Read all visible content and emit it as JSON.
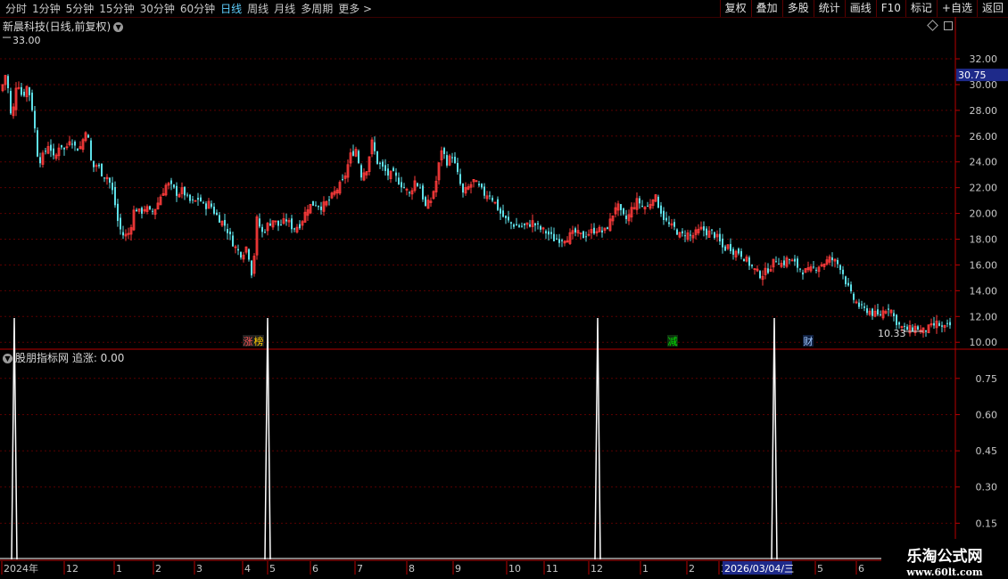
{
  "toolbar": {
    "periods": [
      "分时",
      "1分钟",
      "5分钟",
      "15分钟",
      "30分钟",
      "60分钟",
      "日线",
      "周线",
      "月线",
      "多周期",
      "更多 >"
    ],
    "active_index": 6,
    "right_buttons": [
      "复权",
      "叠加",
      "多股",
      "统计",
      "画线",
      "F10",
      "标记",
      "+自选",
      "返回"
    ]
  },
  "main": {
    "title": "新晨科技(日线,前复权)",
    "last_price": "30.75",
    "high_label": "33.00",
    "low_label": "10.33",
    "markers": [
      {
        "label": "涨",
        "color": "#ff5555",
        "bg": "#202020"
      },
      {
        "label": "榜",
        "color": "#ffcc00",
        "bg": "#202020"
      },
      {
        "label": "减",
        "color": "#00e000",
        "bg": "#103010"
      },
      {
        "label": "财",
        "color": "#a0c8ff",
        "bg": "#102040"
      }
    ]
  },
  "indicator": {
    "title": "股朋指标网 追涨: 0.00"
  },
  "date_axis": {
    "labels": [
      "2024年",
      "12",
      "1",
      "2",
      "3",
      "4",
      "5",
      "6",
      "7",
      "8",
      "9",
      "10",
      "11",
      "12",
      "1",
      "2",
      "3",
      "5",
      "6"
    ],
    "cursor_date": "2026/03/04/三"
  },
  "watermark": {
    "line1": "乐淘公式网",
    "line2": "www.60lt.com"
  },
  "colors": {
    "up": "#ff3b3b",
    "down": "#5ee0e8",
    "axis": "#b80000",
    "grid": "#5a0000",
    "bg": "#000000",
    "signal": "#ffffff"
  },
  "chart_data": [
    {
      "type": "candlestick",
      "title": "新晨科技(日线,前复权)",
      "y_ticks": [
        10.0,
        12.0,
        14.0,
        16.0,
        18.0,
        20.0,
        22.0,
        24.0,
        26.0,
        28.0,
        30.0,
        32.0
      ],
      "ylim": [
        9.6,
        33.8
      ],
      "grid": true,
      "annotations": [
        {
          "text": "33.00",
          "kind": "high"
        },
        {
          "text": "10.33",
          "kind": "low"
        },
        {
          "text": "30.75",
          "kind": "last"
        }
      ],
      "close_path": [
        [
          0,
          29.5
        ],
        [
          6,
          31.0
        ],
        [
          12,
          27.0
        ],
        [
          18,
          30.5
        ],
        [
          24,
          29.0
        ],
        [
          30,
          30.0
        ],
        [
          36,
          27.8
        ],
        [
          42,
          24.0
        ],
        [
          48,
          24.5
        ],
        [
          54,
          25.5
        ],
        [
          60,
          24.0
        ],
        [
          66,
          25.5
        ],
        [
          72,
          24.8
        ],
        [
          78,
          26.0
        ],
        [
          84,
          25.0
        ],
        [
          90,
          25.2
        ],
        [
          96,
          26.8
        ],
        [
          102,
          23.5
        ],
        [
          108,
          23.8
        ],
        [
          114,
          23.0
        ],
        [
          120,
          22.8
        ],
        [
          126,
          21.5
        ],
        [
          132,
          19.0
        ],
        [
          138,
          18.2
        ],
        [
          144,
          18.5
        ],
        [
          150,
          20.5
        ],
        [
          156,
          20.0
        ],
        [
          162,
          20.5
        ],
        [
          168,
          20.0
        ],
        [
          174,
          20.5
        ],
        [
          180,
          21.5
        ],
        [
          186,
          22.3
        ],
        [
          192,
          22.0
        ],
        [
          198,
          21.5
        ],
        [
          204,
          21.8
        ],
        [
          210,
          21.0
        ],
        [
          216,
          20.8
        ],
        [
          222,
          21.2
        ],
        [
          228,
          20.5
        ],
        [
          234,
          20.8
        ],
        [
          240,
          20.0
        ],
        [
          246,
          19.5
        ],
        [
          252,
          19.0
        ],
        [
          258,
          18.0
        ],
        [
          264,
          17.2
        ],
        [
          270,
          16.8
        ],
        [
          276,
          17.5
        ],
        [
          282,
          15.0
        ],
        [
          287,
          19.5
        ],
        [
          293,
          18.5
        ],
        [
          298,
          19.0
        ],
        [
          305,
          19.5
        ],
        [
          312,
          19.0
        ],
        [
          320,
          19.5
        ],
        [
          328,
          18.8
        ],
        [
          336,
          19.2
        ],
        [
          344,
          20.5
        ],
        [
          352,
          20.8
        ],
        [
          360,
          20.5
        ],
        [
          368,
          21.0
        ],
        [
          376,
          21.8
        ],
        [
          384,
          22.5
        ],
        [
          392,
          24.5
        ],
        [
          398,
          25.0
        ],
        [
          404,
          23.0
        ],
        [
          410,
          23.5
        ],
        [
          416,
          25.5
        ],
        [
          422,
          24.0
        ],
        [
          428,
          23.5
        ],
        [
          434,
          23.0
        ],
        [
          440,
          23.0
        ],
        [
          446,
          22.5
        ],
        [
          452,
          22.0
        ],
        [
          458,
          21.5
        ],
        [
          464,
          22.5
        ],
        [
          470,
          22.0
        ],
        [
          476,
          20.5
        ],
        [
          482,
          21.0
        ],
        [
          488,
          22.5
        ],
        [
          494,
          25.0
        ],
        [
          500,
          24.0
        ],
        [
          506,
          24.5
        ],
        [
          512,
          23.0
        ],
        [
          518,
          21.5
        ],
        [
          524,
          22.0
        ],
        [
          530,
          22.5
        ],
        [
          536,
          22.0
        ],
        [
          542,
          21.5
        ],
        [
          548,
          21.5
        ],
        [
          554,
          20.8
        ],
        [
          560,
          20.0
        ],
        [
          566,
          19.5
        ],
        [
          572,
          19.2
        ],
        [
          580,
          19.0
        ],
        [
          588,
          19.0
        ],
        [
          596,
          19.3
        ],
        [
          604,
          18.8
        ],
        [
          612,
          18.5
        ],
        [
          620,
          18.0
        ],
        [
          628,
          18.0
        ],
        [
          636,
          18.2
        ],
        [
          644,
          18.5
        ],
        [
          652,
          18.2
        ],
        [
          660,
          18.5
        ],
        [
          668,
          18.8
        ],
        [
          676,
          18.5
        ],
        [
          684,
          19.5
        ],
        [
          690,
          20.8
        ],
        [
          696,
          19.8
        ],
        [
          702,
          19.5
        ],
        [
          708,
          20.5
        ],
        [
          714,
          21.0
        ],
        [
          720,
          20.5
        ],
        [
          726,
          20.5
        ],
        [
          732,
          21.5
        ],
        [
          738,
          20.5
        ],
        [
          744,
          19.5
        ],
        [
          750,
          19.0
        ],
        [
          756,
          18.8
        ],
        [
          762,
          18.2
        ],
        [
          768,
          18.5
        ],
        [
          774,
          18.2
        ],
        [
          780,
          18.5
        ],
        [
          786,
          18.8
        ],
        [
          792,
          18.5
        ],
        [
          798,
          18.5
        ],
        [
          804,
          18.0
        ],
        [
          810,
          17.2
        ],
        [
          816,
          17.5
        ],
        [
          822,
          17.0
        ],
        [
          828,
          17.0
        ],
        [
          834,
          16.5
        ],
        [
          840,
          16.0
        ],
        [
          846,
          15.5
        ],
        [
          852,
          15.2
        ],
        [
          858,
          15.5
        ],
        [
          864,
          16.0
        ],
        [
          870,
          16.5
        ],
        [
          876,
          16.0
        ],
        [
          882,
          16.5
        ],
        [
          888,
          16.2
        ],
        [
          894,
          15.8
        ],
        [
          900,
          15.5
        ],
        [
          906,
          15.5
        ],
        [
          912,
          15.8
        ],
        [
          918,
          16.0
        ],
        [
          924,
          16.2
        ],
        [
          930,
          16.5
        ],
        [
          936,
          16.2
        ],
        [
          942,
          15.8
        ],
        [
          948,
          14.5
        ],
        [
          954,
          13.5
        ],
        [
          960,
          13.0
        ],
        [
          966,
          12.5
        ],
        [
          972,
          12.5
        ],
        [
          978,
          12.2
        ],
        [
          984,
          12.0
        ],
        [
          990,
          12.5
        ],
        [
          996,
          12.8
        ],
        [
          1002,
          11.8
        ],
        [
          1008,
          11.2
        ],
        [
          1014,
          11.0
        ],
        [
          1020,
          11.0
        ],
        [
          1026,
          11.2
        ],
        [
          1032,
          10.8
        ],
        [
          1038,
          11.0
        ],
        [
          1044,
          11.2
        ],
        [
          1050,
          11.5
        ],
        [
          1056,
          11.0
        ],
        [
          1064,
          11.3
        ]
      ]
    },
    {
      "type": "line",
      "title": "股朋指标网 追涨: 0.00",
      "series": [
        {
          "name": "追涨",
          "signals_at_x": [
            16,
            300,
            670,
            868
          ],
          "value": 1
        }
      ],
      "y_ticks": [
        0.15,
        0.3,
        0.45,
        0.6,
        0.75
      ],
      "ylim": [
        0,
        0.86
      ]
    }
  ]
}
